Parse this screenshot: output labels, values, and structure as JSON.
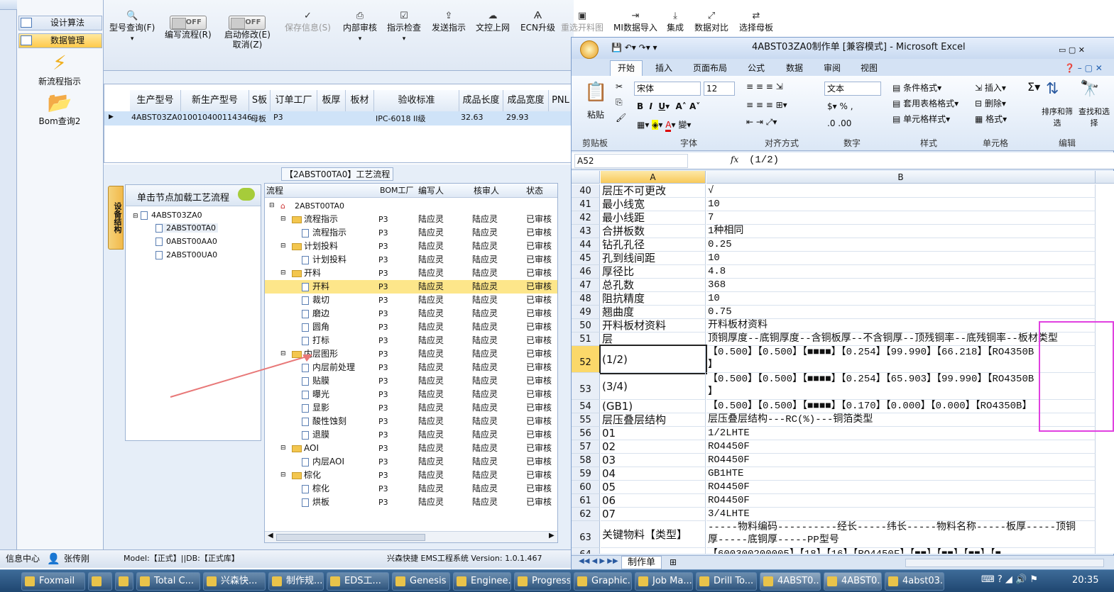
{
  "app": {
    "sidebar": {
      "items": [
        {
          "label": "设计算法"
        },
        {
          "label": "数据管理"
        }
      ],
      "big_items": [
        {
          "label": "新流程指示",
          "icon": "lightning-icon"
        },
        {
          "label": "Bom查询2",
          "icon": "folder-open-icon"
        }
      ]
    },
    "ribbon": {
      "buttons": [
        {
          "label": "型号查询(F)",
          "icon": "search-icon"
        },
        {
          "label": "编写流程(R)",
          "toggle": "OFF"
        },
        {
          "label": "启动修改(E)",
          "label2": "取消(Z)",
          "toggle": "OFF"
        },
        {
          "label": "保存信息(S)",
          "icon": "check-icon",
          "disabled": true
        },
        {
          "label": "内部审核",
          "icon": "print-icon"
        },
        {
          "label": "指示检查",
          "icon": "checklist-icon"
        },
        {
          "label": "发送指示",
          "icon": "upload-icon"
        },
        {
          "label": "文控上网",
          "icon": "cloud-upload-icon"
        },
        {
          "label": "ECN升级",
          "icon": "ecn-icon"
        },
        {
          "label": "重选开料图",
          "icon": "image-icon",
          "disabled": true
        },
        {
          "label": "MI数据导入",
          "icon": "import-icon"
        },
        {
          "label": "集成",
          "icon": "download-icon"
        },
        {
          "label": "数据对比",
          "icon": "compare-icon"
        },
        {
          "label": "选择母板",
          "icon": "shuffle-icon"
        }
      ]
    },
    "top_grid": {
      "headers": [
        "生产型号",
        "新生产型号",
        "S板",
        "订单工厂",
        "板厚",
        "板材",
        "验收标准",
        "成品长度",
        "成品宽度",
        "PNL"
      ],
      "row": [
        "4ABST03ZA0",
        "10010400114346",
        "母板",
        "P3",
        "",
        "",
        "IPC-6018 II级",
        "32.63",
        "29.93",
        ""
      ]
    },
    "mid_header": "【2ABST00TA0】工艺流程",
    "left_tree": {
      "title": "单击节点加载工艺流程",
      "side_tab": "设备结构",
      "root": "4ABST03ZA0",
      "children": [
        "2ABST00TA0",
        "0ABST00AA0",
        "2ABST00UA0"
      ]
    },
    "flow": {
      "headers": [
        "流程",
        "BOM工厂",
        "编写人",
        "核审人",
        "状态"
      ],
      "root": "2ABST00TA0",
      "rows": [
        {
          "name": "流程指示",
          "level": 1,
          "folder": true
        },
        {
          "name": "流程指示",
          "level": 2,
          "folder": false
        },
        {
          "name": "计划投料",
          "level": 1,
          "folder": true
        },
        {
          "name": "计划投料",
          "level": 2,
          "folder": false
        },
        {
          "name": "开料",
          "level": 1,
          "folder": true
        },
        {
          "name": "开料",
          "level": 2,
          "folder": false,
          "selected": true
        },
        {
          "name": "裁切",
          "level": 2,
          "folder": false
        },
        {
          "name": "磨边",
          "level": 2,
          "folder": false
        },
        {
          "name": "圆角",
          "level": 2,
          "folder": false
        },
        {
          "name": "打标",
          "level": 2,
          "folder": false
        },
        {
          "name": "内层图形",
          "level": 1,
          "folder": true
        },
        {
          "name": "内层前处理",
          "level": 2,
          "folder": false
        },
        {
          "name": "贴膜",
          "level": 2,
          "folder": false
        },
        {
          "name": "曝光",
          "level": 2,
          "folder": false
        },
        {
          "name": "显影",
          "level": 2,
          "folder": false
        },
        {
          "name": "酸性蚀刻",
          "level": 2,
          "folder": false
        },
        {
          "name": "退膜",
          "level": 2,
          "folder": false
        },
        {
          "name": "AOI",
          "level": 1,
          "folder": true
        },
        {
          "name": "内层AOI",
          "level": 2,
          "folder": false
        },
        {
          "name": "棕化",
          "level": 1,
          "folder": true
        },
        {
          "name": "棕化",
          "level": 2,
          "folder": false
        },
        {
          "name": "烘板",
          "level": 2,
          "folder": false
        }
      ],
      "bom": "P3",
      "writer": "陆应灵",
      "reviewer": "陆应灵",
      "status": "已审核"
    },
    "status_bar": {
      "info": "信息中心",
      "user": "张传刚",
      "model": "Model:【正式】||DB:【正式库】",
      "version": "兴森快捷 EMS工程系统 Version: 1.0.1.467"
    }
  },
  "excel": {
    "title": "4ABST03ZA0制作单 [兼容模式] - Microsoft Excel",
    "tabs": [
      "开始",
      "插入",
      "页面布局",
      "公式",
      "数据",
      "审阅",
      "视图"
    ],
    "font_name": "宋体",
    "font_size": "12",
    "number_format": "文本",
    "groups": [
      "剪贴板",
      "字体",
      "对齐方式",
      "数字",
      "样式",
      "单元格",
      "编辑"
    ],
    "labels": {
      "paste": "粘贴",
      "cond_format": "条件格式",
      "table_format": "套用表格格式",
      "cell_style": "单元格样式",
      "insert": "插入",
      "delete": "删除",
      "format": "格式",
      "sort": "排序和筛选",
      "find": "查找和选择"
    },
    "name_box": "A52",
    "formula": "(1/2)",
    "columns": [
      "A",
      "B"
    ],
    "rows": [
      {
        "n": "40",
        "a": "层压不可更改",
        "b": "√"
      },
      {
        "n": "41",
        "a": "最小线宽",
        "b": "10"
      },
      {
        "n": "42",
        "a": "最小线距",
        "b": "7"
      },
      {
        "n": "43",
        "a": "合拼板数",
        "b": "1种相同"
      },
      {
        "n": "44",
        "a": "钻孔孔径",
        "b": "0.25"
      },
      {
        "n": "45",
        "a": "孔到线间距",
        "b": "10"
      },
      {
        "n": "46",
        "a": "厚径比",
        "b": "4.8"
      },
      {
        "n": "47",
        "a": "总孔数",
        "b": "368"
      },
      {
        "n": "48",
        "a": "阻抗精度",
        "b": "10"
      },
      {
        "n": "49",
        "a": "翘曲度",
        "b": "0.75"
      },
      {
        "n": "50",
        "a": "开料板材资料",
        "b": "开料板材资料"
      },
      {
        "n": "51",
        "a": "层",
        "b": "顶铜厚度--底铜厚度--含铜板厚--不含铜厚--顶残铜率--底残铜率--板材类型"
      },
      {
        "n": "52",
        "a": "(1/2)",
        "b": "【0.500】【0.500】【■■■■】【0.254】【99.990】【66.218】【RO4350B",
        "b2": "】"
      },
      {
        "n": "53",
        "a": "(3/4)",
        "b": "【0.500】【0.500】【■■■■】【0.254】【65.903】【99.990】【RO4350B",
        "b2": "】"
      },
      {
        "n": "54",
        "a": "(GB1)",
        "b": "【0.500】【0.500】【■■■■】【0.170】【0.000】【0.000】【RO4350B】"
      },
      {
        "n": "55",
        "a": "层压叠层结构",
        "b": "层压叠层结构---RC(%)---铜箔类型"
      },
      {
        "n": "56",
        "a": "01",
        "b": "1/2LHTE"
      },
      {
        "n": "57",
        "a": "02",
        "b": "RO4450F"
      },
      {
        "n": "58",
        "a": "03",
        "b": "RO4450F"
      },
      {
        "n": "59",
        "a": "04",
        "b": "GB1HTE"
      },
      {
        "n": "60",
        "a": "05",
        "b": "RO4450F"
      },
      {
        "n": "61",
        "a": "06",
        "b": "RO4450F"
      },
      {
        "n": "62",
        "a": "07",
        "b": "3/4LHTE"
      },
      {
        "n": "63",
        "a": "关键物料【类型】",
        "b": "-----物料编码----------经长-----纬长-----物料名称-----板厚-----顶铜",
        "b2": "厚-----底铜厚-----PP型号"
      },
      {
        "n": "64",
        "a": "",
        "b": "【600300200005】【18】【16】【RO4450F】【■■】【■■】【■■】【■"
      }
    ],
    "sheet_tab": "制作单"
  },
  "taskbar": {
    "items": [
      "Foxmail",
      "",
      "",
      "Total C...",
      "兴森快...",
      "制作规...",
      "EDS工...",
      "Genesis",
      "Enginee...",
      "Progress",
      "Graphic...",
      "Job Ma...",
      "Drill To...",
      "4ABST0...",
      "4ABST0...",
      "4abst03..."
    ],
    "time": "20:35"
  },
  "colors": {
    "accent": "#ffc94a",
    "selected_row": "#fde68a",
    "magenta_box": "#e040e0",
    "arrow": "#e87878"
  }
}
